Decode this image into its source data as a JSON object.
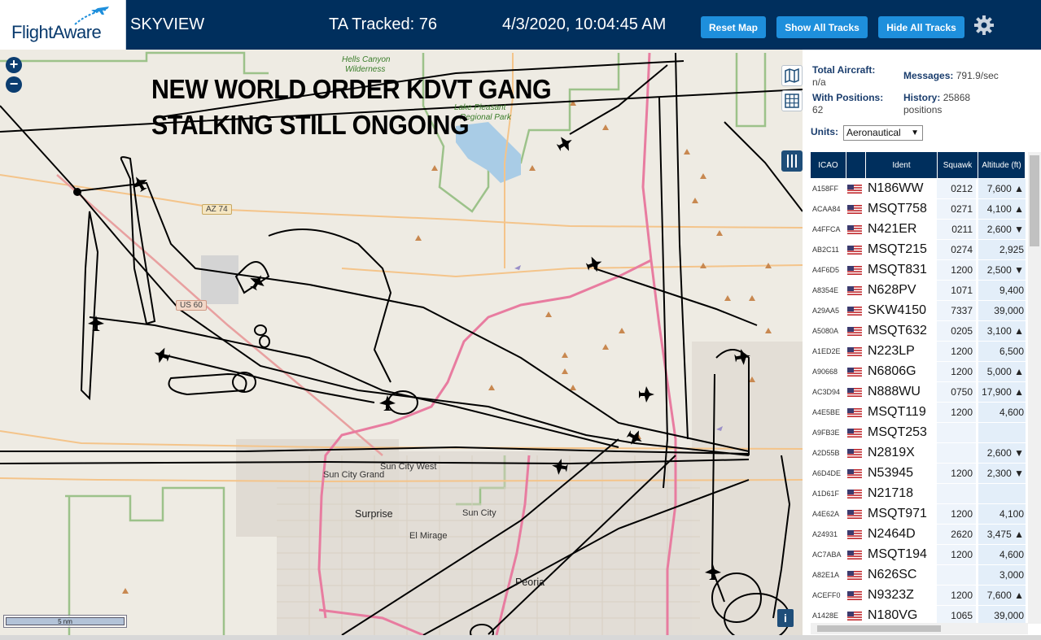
{
  "header": {
    "logo_text": "FlightAware",
    "app_title": "SKYVIEW",
    "tracked": "TA Tracked: 76",
    "clock": "4/3/2020, 10:04:45 AM",
    "reset_label": "Reset Map",
    "show_label": "Show All Tracks",
    "hide_label": "Hide All Tracks"
  },
  "map": {
    "overlay_line1": "NEW WORLD ORDER KDVT GANG",
    "overlay_line2": "STALKING STILL ONGOING",
    "scale_label": "5 nm",
    "places": {
      "hells_canyon": "Hells Canyon",
      "wilderness": "Wilderness",
      "lake_pleasant": "Lake Pleasant",
      "lake_pleasant2": "Regional Park",
      "sun_city_grand": "Sun City Grand",
      "sun_city_west": "Sun City West",
      "surprise": "Surprise",
      "sun_city": "Sun City",
      "el_mirage": "El Mirage",
      "peoria": "Peoria"
    },
    "roads": {
      "az74": "AZ 74",
      "us60": "US 60"
    }
  },
  "sidebar": {
    "total_label": "Total Aircraft:",
    "total_value": "n/a",
    "messages_label": "Messages:",
    "messages_value": "791.9/sec",
    "with_pos_label": "With Positions:",
    "with_pos_value": "62",
    "history_label": "History:",
    "history_value": "25868",
    "history_unit": "positions",
    "units_label": "Units:",
    "units_value": "Aeronautical",
    "columns": [
      "ICAO",
      "Ident",
      "Squawk",
      "Altitude (ft)"
    ],
    "rows": [
      {
        "icao": "A158FF",
        "ident": "N186WW",
        "squawk": "0212",
        "alt": "7,600 ▲"
      },
      {
        "icao": "ACAA84",
        "ident": "MSQT758",
        "squawk": "0271",
        "alt": "4,100 ▲"
      },
      {
        "icao": "A4FFCA",
        "ident": "N421ER",
        "squawk": "0211",
        "alt": "2,600 ▼"
      },
      {
        "icao": "AB2C11",
        "ident": "MSQT215",
        "squawk": "0274",
        "alt": "2,925"
      },
      {
        "icao": "A4F6D5",
        "ident": "MSQT831",
        "squawk": "1200",
        "alt": "2,500 ▼"
      },
      {
        "icao": "A8354E",
        "ident": "N628PV",
        "squawk": "1071",
        "alt": "9,400"
      },
      {
        "icao": "A29AA5",
        "ident": "SKW4150",
        "squawk": "7337",
        "alt": "39,000"
      },
      {
        "icao": "A5080A",
        "ident": "MSQT632",
        "squawk": "0205",
        "alt": "3,100 ▲"
      },
      {
        "icao": "A1ED2E",
        "ident": "N223LP",
        "squawk": "1200",
        "alt": "6,500"
      },
      {
        "icao": "A90668",
        "ident": "N6806G",
        "squawk": "1200",
        "alt": "5,000 ▲"
      },
      {
        "icao": "AC3D94",
        "ident": "N888WU",
        "squawk": "0750",
        "alt": "17,900 ▲"
      },
      {
        "icao": "A4E5BE",
        "ident": "MSQT119",
        "squawk": "1200",
        "alt": "4,600"
      },
      {
        "icao": "A9FB3E",
        "ident": "MSQT253",
        "squawk": "",
        "alt": ""
      },
      {
        "icao": "A2D55B",
        "ident": "N2819X",
        "squawk": "",
        "alt": "2,600 ▼"
      },
      {
        "icao": "A6D4DE",
        "ident": "N53945",
        "squawk": "1200",
        "alt": "2,300 ▼"
      },
      {
        "icao": "A1D61F",
        "ident": "N21718",
        "squawk": "",
        "alt": ""
      },
      {
        "icao": "A4E62A",
        "ident": "MSQT971",
        "squawk": "1200",
        "alt": "4,100"
      },
      {
        "icao": "A24931",
        "ident": "N2464D",
        "squawk": "2620",
        "alt": "3,475 ▲"
      },
      {
        "icao": "AC7ABA",
        "ident": "MSQT194",
        "squawk": "1200",
        "alt": "4,600"
      },
      {
        "icao": "A82E1A",
        "ident": "N626SC",
        "squawk": "",
        "alt": "3,000"
      },
      {
        "icao": "ACEFF0",
        "ident": "N9323Z",
        "squawk": "1200",
        "alt": "7,600 ▲"
      },
      {
        "icao": "A1428E",
        "ident": "N180VG",
        "squawk": "1065",
        "alt": "39,000"
      }
    ]
  },
  "colors": {
    "header_bg": "#002f5d",
    "button": "#1e8fdc",
    "track": "#000000"
  },
  "icons": [
    "plane-logo-icon",
    "gear-icon",
    "zoom-in-icon",
    "zoom-out-icon",
    "map-icon",
    "grid-icon",
    "columns-icon",
    "info-icon",
    "us-flag-icon"
  ]
}
